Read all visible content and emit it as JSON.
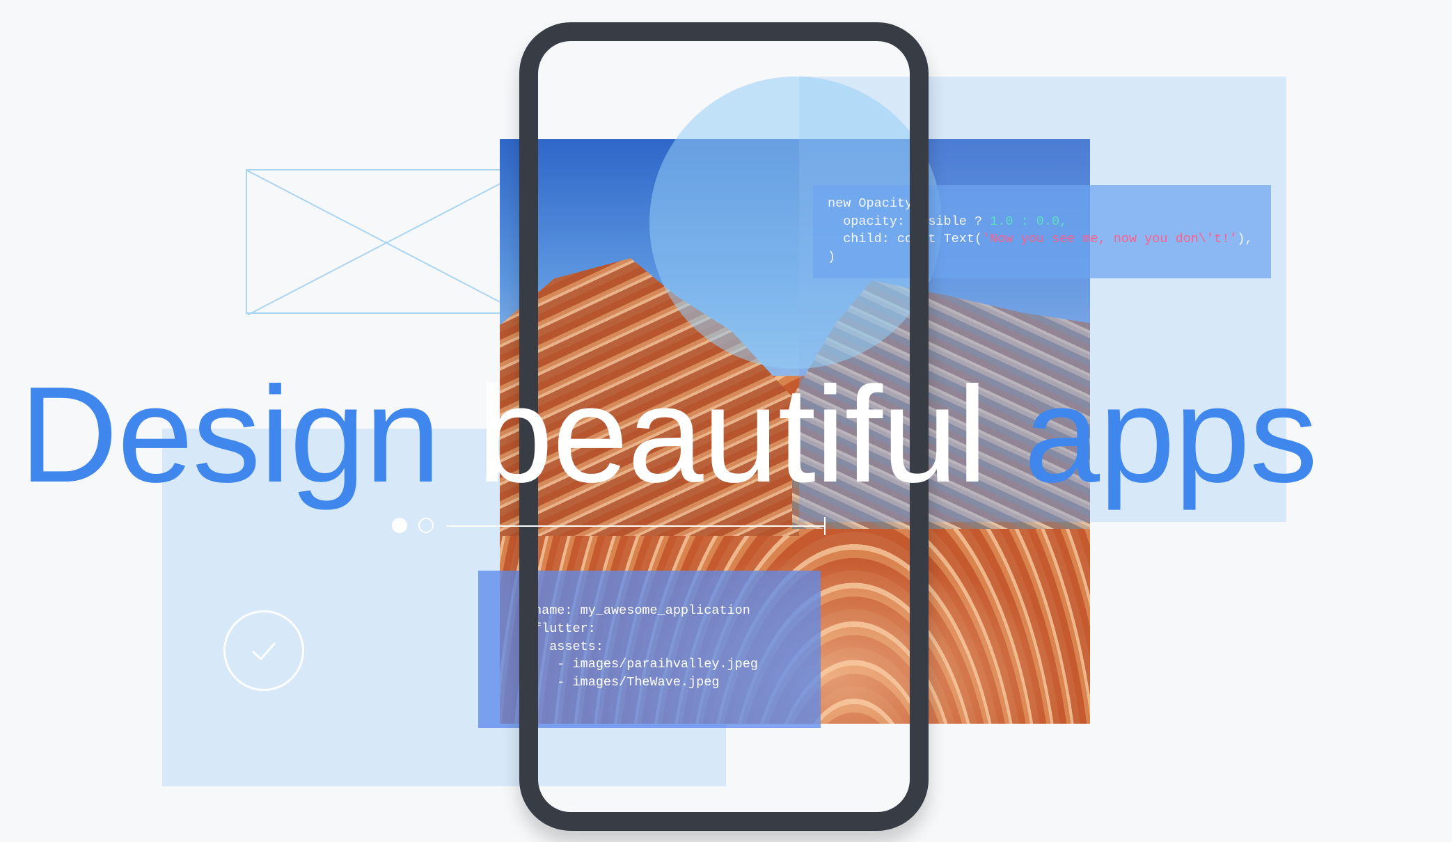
{
  "headline": {
    "word1": "Design",
    "word2": "beautiful",
    "word3": "apps"
  },
  "code_top": {
    "line1": "new Opacity(",
    "line2_prefix": "  opacity: visible ? ",
    "line2_num1": "1.0",
    "line2_sep": " : ",
    "line2_num2": "0.0",
    "line2_suffix": ",",
    "line3_prefix": "  child: const Text(",
    "line3_str": "'Now you see me, now you don\\'t!'",
    "line3_suffix": "),",
    "line4": ")"
  },
  "code_bottom": {
    "line1": "name: my_awesome_application",
    "line2": "flutter:",
    "line3": "  assets:",
    "line4": "   - images/paraihvalley.jpeg",
    "line5": "   - images/TheWave.jpeg"
  },
  "icons": {
    "checkmark": "check-icon",
    "wireframe": "image-placeholder-icon",
    "pager": "pager-dots"
  },
  "colors": {
    "accent_blue": "#3f87ec",
    "panel_light": "#d7e8f8",
    "phone_frame": "#383c44",
    "code_number": "#5be0c2",
    "code_string": "#ff5f8a"
  }
}
